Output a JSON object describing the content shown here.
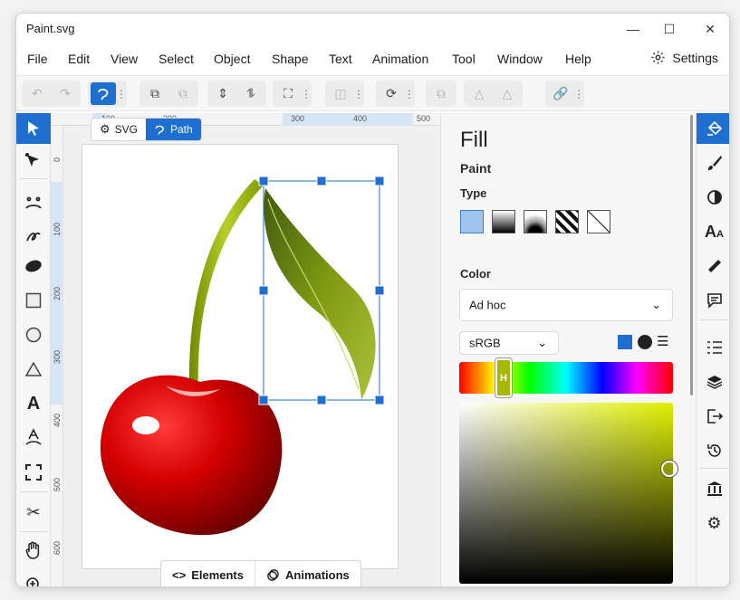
{
  "window": {
    "title": "Paint.svg",
    "minimize_icon": "—",
    "maximize_icon": "☐",
    "close_icon": "✕"
  },
  "menu": {
    "items": [
      "File",
      "Edit",
      "View",
      "Select",
      "Object",
      "Shape",
      "Text",
      "Animation",
      "Tool",
      "Window",
      "Help"
    ],
    "settings_label": "Settings"
  },
  "mode_tabs": {
    "svg_label": "SVG",
    "path_label": "Path",
    "active": "Path"
  },
  "rulers": {
    "top": [
      "100",
      "200",
      "300",
      "400",
      "500"
    ],
    "left": [
      "0",
      "100",
      "200",
      "300",
      "400",
      "500",
      "600"
    ]
  },
  "bottom_tabs": {
    "elements_label": "Elements",
    "animations_label": "Animations"
  },
  "panel": {
    "title": "Fill",
    "paint_label": "Paint",
    "type_label": "Type",
    "color_label": "Color",
    "color_mode": "Ad hoc",
    "color_space": "sRGB",
    "hue_marker": "H",
    "selected_color": "#d3e200"
  },
  "colors": {
    "accent": "#1e6fd0"
  }
}
